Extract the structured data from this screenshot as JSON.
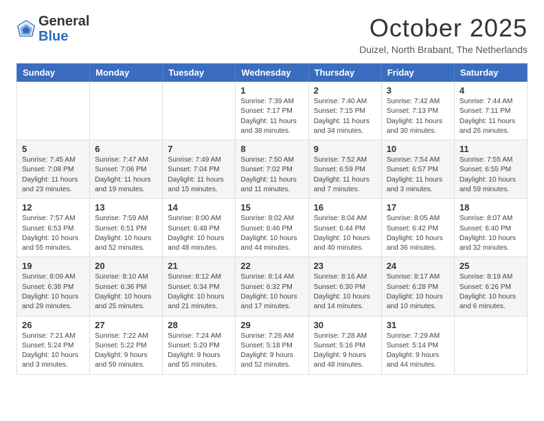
{
  "header": {
    "logo_general": "General",
    "logo_blue": "Blue",
    "title": "October 2025",
    "subtitle": "Duizel, North Brabant, The Netherlands"
  },
  "weekdays": [
    "Sunday",
    "Monday",
    "Tuesday",
    "Wednesday",
    "Thursday",
    "Friday",
    "Saturday"
  ],
  "weeks": [
    [
      {
        "day": "",
        "info": ""
      },
      {
        "day": "",
        "info": ""
      },
      {
        "day": "",
        "info": ""
      },
      {
        "day": "1",
        "info": "Sunrise: 7:39 AM\nSunset: 7:17 PM\nDaylight: 11 hours\nand 38 minutes."
      },
      {
        "day": "2",
        "info": "Sunrise: 7:40 AM\nSunset: 7:15 PM\nDaylight: 11 hours\nand 34 minutes."
      },
      {
        "day": "3",
        "info": "Sunrise: 7:42 AM\nSunset: 7:13 PM\nDaylight: 11 hours\nand 30 minutes."
      },
      {
        "day": "4",
        "info": "Sunrise: 7:44 AM\nSunset: 7:11 PM\nDaylight: 11 hours\nand 26 minutes."
      }
    ],
    [
      {
        "day": "5",
        "info": "Sunrise: 7:45 AM\nSunset: 7:08 PM\nDaylight: 11 hours\nand 23 minutes."
      },
      {
        "day": "6",
        "info": "Sunrise: 7:47 AM\nSunset: 7:06 PM\nDaylight: 11 hours\nand 19 minutes."
      },
      {
        "day": "7",
        "info": "Sunrise: 7:49 AM\nSunset: 7:04 PM\nDaylight: 11 hours\nand 15 minutes."
      },
      {
        "day": "8",
        "info": "Sunrise: 7:50 AM\nSunset: 7:02 PM\nDaylight: 11 hours\nand 11 minutes."
      },
      {
        "day": "9",
        "info": "Sunrise: 7:52 AM\nSunset: 6:59 PM\nDaylight: 11 hours\nand 7 minutes."
      },
      {
        "day": "10",
        "info": "Sunrise: 7:54 AM\nSunset: 6:57 PM\nDaylight: 11 hours\nand 3 minutes."
      },
      {
        "day": "11",
        "info": "Sunrise: 7:55 AM\nSunset: 6:55 PM\nDaylight: 10 hours\nand 59 minutes."
      }
    ],
    [
      {
        "day": "12",
        "info": "Sunrise: 7:57 AM\nSunset: 6:53 PM\nDaylight: 10 hours\nand 55 minutes."
      },
      {
        "day": "13",
        "info": "Sunrise: 7:59 AM\nSunset: 6:51 PM\nDaylight: 10 hours\nand 52 minutes."
      },
      {
        "day": "14",
        "info": "Sunrise: 8:00 AM\nSunset: 6:48 PM\nDaylight: 10 hours\nand 48 minutes."
      },
      {
        "day": "15",
        "info": "Sunrise: 8:02 AM\nSunset: 6:46 PM\nDaylight: 10 hours\nand 44 minutes."
      },
      {
        "day": "16",
        "info": "Sunrise: 8:04 AM\nSunset: 6:44 PM\nDaylight: 10 hours\nand 40 minutes."
      },
      {
        "day": "17",
        "info": "Sunrise: 8:05 AM\nSunset: 6:42 PM\nDaylight: 10 hours\nand 36 minutes."
      },
      {
        "day": "18",
        "info": "Sunrise: 8:07 AM\nSunset: 6:40 PM\nDaylight: 10 hours\nand 32 minutes."
      }
    ],
    [
      {
        "day": "19",
        "info": "Sunrise: 8:09 AM\nSunset: 6:38 PM\nDaylight: 10 hours\nand 29 minutes."
      },
      {
        "day": "20",
        "info": "Sunrise: 8:10 AM\nSunset: 6:36 PM\nDaylight: 10 hours\nand 25 minutes."
      },
      {
        "day": "21",
        "info": "Sunrise: 8:12 AM\nSunset: 6:34 PM\nDaylight: 10 hours\nand 21 minutes."
      },
      {
        "day": "22",
        "info": "Sunrise: 8:14 AM\nSunset: 6:32 PM\nDaylight: 10 hours\nand 17 minutes."
      },
      {
        "day": "23",
        "info": "Sunrise: 8:16 AM\nSunset: 6:30 PM\nDaylight: 10 hours\nand 14 minutes."
      },
      {
        "day": "24",
        "info": "Sunrise: 8:17 AM\nSunset: 6:28 PM\nDaylight: 10 hours\nand 10 minutes."
      },
      {
        "day": "25",
        "info": "Sunrise: 8:19 AM\nSunset: 6:26 PM\nDaylight: 10 hours\nand 6 minutes."
      }
    ],
    [
      {
        "day": "26",
        "info": "Sunrise: 7:21 AM\nSunset: 5:24 PM\nDaylight: 10 hours\nand 3 minutes."
      },
      {
        "day": "27",
        "info": "Sunrise: 7:22 AM\nSunset: 5:22 PM\nDaylight: 9 hours\nand 59 minutes."
      },
      {
        "day": "28",
        "info": "Sunrise: 7:24 AM\nSunset: 5:20 PM\nDaylight: 9 hours\nand 55 minutes."
      },
      {
        "day": "29",
        "info": "Sunrise: 7:26 AM\nSunset: 5:18 PM\nDaylight: 9 hours\nand 52 minutes."
      },
      {
        "day": "30",
        "info": "Sunrise: 7:28 AM\nSunset: 5:16 PM\nDaylight: 9 hours\nand 48 minutes."
      },
      {
        "day": "31",
        "info": "Sunrise: 7:29 AM\nSunset: 5:14 PM\nDaylight: 9 hours\nand 44 minutes."
      },
      {
        "day": "",
        "info": ""
      }
    ]
  ]
}
